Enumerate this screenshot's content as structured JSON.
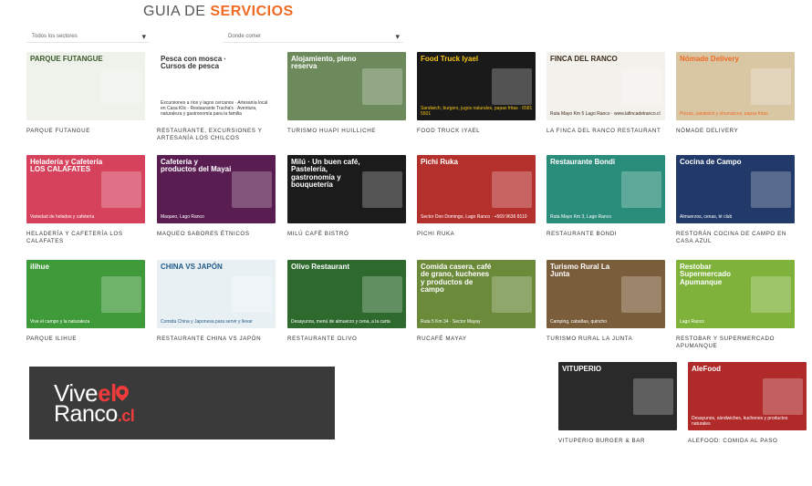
{
  "header": {
    "title_base": "GUIA DE ",
    "title_accent": "SERVICIOS"
  },
  "filters": {
    "sector_placeholder": "Todos los sectores",
    "place_placeholder": "Donde comer"
  },
  "colors": {
    "accent": "#f06a24",
    "logo_bg": "#3a3a3a",
    "logo_red": "#ef3b3b"
  },
  "cards": [
    {
      "label": "PARQUE FUTANGUE",
      "thumb_main": "PARQUE FUTANGUE",
      "thumb_sub": "",
      "bg": "#eef2ea",
      "fg": "#3a5a2a"
    },
    {
      "label": "RESTAURANTE, EXCURSIONES Y ARTESANÍA LOS CHILCOS",
      "thumb_main": "Pesca con mosca · Cursos de pesca",
      "thumb_sub": "Excursiones a ríos y lagos cercanos · Artesanía local en Casa Klic · Restaurante Trucha's · Aventura, naturaleza y gastronomía para la familia",
      "bg": "#ffffff",
      "fg": "#333333"
    },
    {
      "label": "TURISMO HUAPI HUILLICHE",
      "thumb_main": "Alojamiento, pleno reserva",
      "thumb_sub": "",
      "bg": "#6d8a5c",
      "fg": "#ffffff"
    },
    {
      "label": "FOOD TRUCK IYAEL",
      "thumb_main": "Food Truck Iyael",
      "thumb_sub": "Sandwich, burgers, jugos naturales, papas fritas · 6581 5501",
      "bg": "#1a1a1a",
      "fg": "#f5c518"
    },
    {
      "label": "LA FINCA DEL RANCO RESTAURANT",
      "thumb_main": "FINCA DEL RANCO",
      "thumb_sub": "Ruta Mayo Km 5 Lago Ranco · www.lafincadelranco.cl",
      "bg": "#f3f1ec",
      "fg": "#3a2a1a"
    },
    {
      "label": "NÓMADE DELIVERY",
      "thumb_main": "Nómade Delivery",
      "thumb_sub": "Pizzas, sándwich y churrascos, papas fritas",
      "bg": "#d9c7a4",
      "fg": "#f06a24"
    },
    {
      "label": "HELADERÍA Y CAFETERÍA LOS CALAFATES",
      "thumb_main": "Heladería y Cafetería LOS CALAFATES",
      "thumb_sub": "Variedad de helados y cafetería",
      "bg": "#d6415c",
      "fg": "#ffffff"
    },
    {
      "label": "MAQUEO SABORES ÉTNICOS",
      "thumb_main": "Cafetería y productos del Mayai",
      "thumb_sub": "Maqueo, Lago Ranco",
      "bg": "#5a1d52",
      "fg": "#ffffff"
    },
    {
      "label": "MILÚ CAFÉ BISTRÓ",
      "thumb_main": "Milú · Un buen café, Pastelería, gastronomía y bouquetería",
      "thumb_sub": "",
      "bg": "#1b1b1b",
      "fg": "#ffffff"
    },
    {
      "label": "PICHI RUKA",
      "thumb_main": "Pichi Ruka",
      "thumb_sub": "Sector Don Domingo, Lago Ranco · +569 9636 8110",
      "bg": "#b4302c",
      "fg": "#ffffff"
    },
    {
      "label": "RESTAURANTE BONDI",
      "thumb_main": "Restaurante Bondi",
      "thumb_sub": "Ruta Mayo Km 3, Lago Ranco",
      "bg": "#2a8c7a",
      "fg": "#ffffff"
    },
    {
      "label": "RESTORÁN COCINA DE CAMPO EN CASA AZUL",
      "thumb_main": "Cocina de Campo",
      "thumb_sub": "Almuerzos, cenas, té club",
      "bg": "#213a6a",
      "fg": "#ffffff"
    },
    {
      "label": "PARQUE ILIHUE",
      "thumb_main": "ilihue",
      "thumb_sub": "Vive el campo y la naturaleza",
      "bg": "#3f9a3a",
      "fg": "#ffffff"
    },
    {
      "label": "RESTAURANTE CHINA VS JAPÓN",
      "thumb_main": "CHINA VS JAPÓN",
      "thumb_sub": "Comida China y Japonesa para servir y llevar",
      "bg": "#e9f0f4",
      "fg": "#1f5a8a"
    },
    {
      "label": "RESTAURANTE OLIVO",
      "thumb_main": "Olivo Restaurant",
      "thumb_sub": "Desayunos, menú de almuerzo y cena, a la carta",
      "bg": "#2e6a2e",
      "fg": "#ffffff"
    },
    {
      "label": "RUCAFÉ MAYAY",
      "thumb_main": "Comida casera, café de grano, kuchenes y productos de campo",
      "thumb_sub": "Ruta 5 Km 34 · Sector Mayay",
      "bg": "#6b8a3a",
      "fg": "#ffffff"
    },
    {
      "label": "TURISMO RURAL LA JUNTA",
      "thumb_main": "Turismo Rural La Junta",
      "thumb_sub": "Camping, cabañas, quincho",
      "bg": "#7a5d3a",
      "fg": "#ffffff"
    },
    {
      "label": "RESTOBAR Y SUPERMERCADO APUMANQUE",
      "thumb_main": "Restobar Supermercado Apumanque",
      "thumb_sub": "Lago Ranco",
      "bg": "#7fb23a",
      "fg": "#ffffff"
    },
    {
      "label": "VITUPERIO BURGER & BAR",
      "thumb_main": "VITUPERIO",
      "thumb_sub": "",
      "bg": "#2a2a2a",
      "fg": "#ffffff"
    },
    {
      "label": "ALEFOOD: COMIDA AL PASO",
      "thumb_main": "AleFood",
      "thumb_sub": "Desayunos, sándwiches, kuchenes y productos naturales",
      "bg": "#b12a2a",
      "fg": "#ffffff"
    }
  ],
  "logo": {
    "line1_a": "Vive",
    "line1_b": "el",
    "line2_a": "Ranco",
    "line2_b": ".cl"
  }
}
